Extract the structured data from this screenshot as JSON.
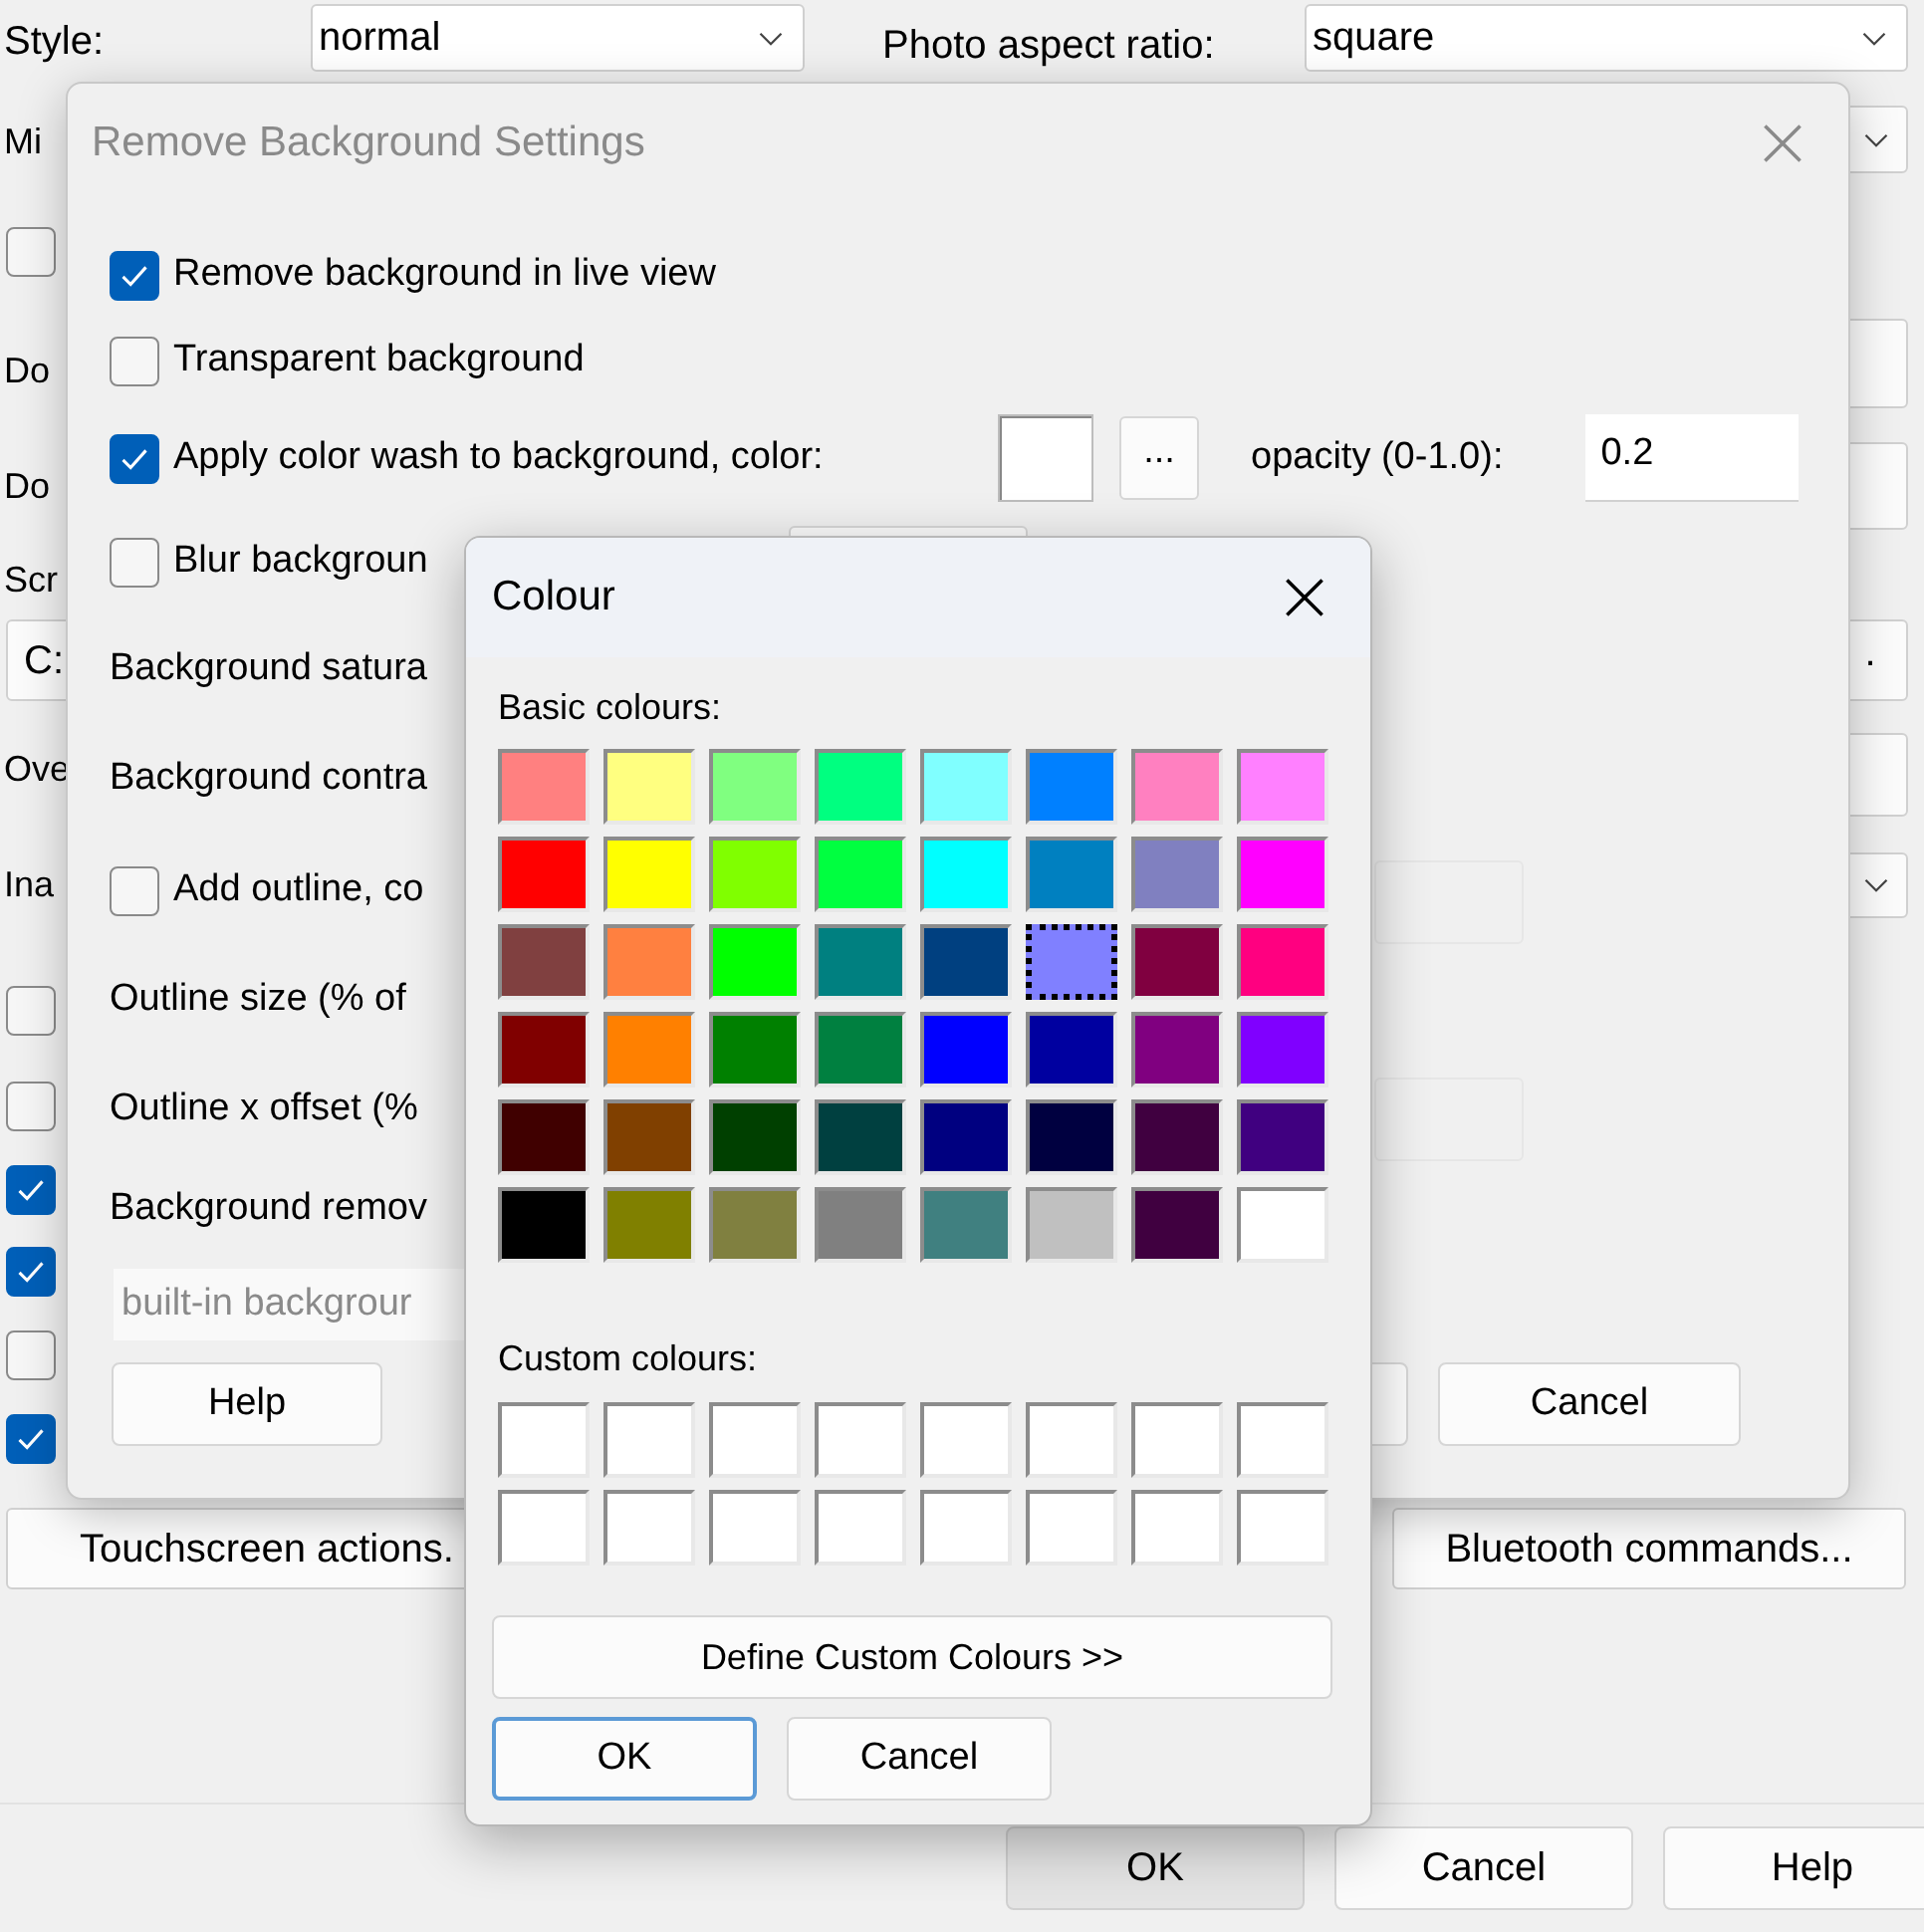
{
  "main_window": {
    "style_label": "Style:",
    "style_value": "normal",
    "aspect_label": "Photo aspect ratio:",
    "aspect_value": "square",
    "left_labels": [
      "Mi",
      "Do",
      "Do",
      "Scr",
      "Ove",
      "Ina"
    ],
    "path_field": "C:",
    "checkboxes": [
      {
        "checked": false
      },
      {
        "checked": false
      },
      {
        "checked": false
      },
      {
        "checked": true
      },
      {
        "checked": true
      },
      {
        "checked": false
      },
      {
        "checked": true
      }
    ],
    "right_controls": [
      {
        "kind": "dropdown"
      },
      {
        "kind": "field"
      },
      {
        "kind": "field"
      },
      {
        "kind": "button",
        "label": "."
      },
      {
        "kind": "field"
      },
      {
        "kind": "dropdown"
      }
    ],
    "buttons": [
      "Touchscreen actions.",
      "Bluetooth commands..."
    ],
    "footer_buttons": [
      {
        "label": "OK",
        "default": true
      },
      {
        "label": "Cancel",
        "default": false
      },
      {
        "label": "Help",
        "default": false
      }
    ]
  },
  "settings_dialog": {
    "title": "Remove Background Settings",
    "active": false,
    "rows": [
      {
        "kind": "checkbox",
        "label": "Remove background in live view",
        "checked": true
      },
      {
        "kind": "checkbox",
        "label": "Transparent background",
        "checked": false
      },
      {
        "kind": "color",
        "label": "Apply color wash to background, color:",
        "checked": true,
        "color": "#ffffff",
        "picker": "...",
        "opacity_label": "opacity (0-1.0):",
        "opacity": "0.2"
      },
      {
        "kind": "checkbox",
        "label": "Blur backgroun",
        "checked": false,
        "field_enabled": true
      },
      {
        "kind": "label",
        "label": "Background satura"
      },
      {
        "kind": "label",
        "label": "Background contra"
      },
      {
        "kind": "checkbox",
        "label": "Add outline, co",
        "checked": false,
        "field_enabled": false
      },
      {
        "kind": "label",
        "label": "Outline size (% of"
      },
      {
        "kind": "label",
        "label": "Outline x offset (%",
        "field_enabled": false
      },
      {
        "kind": "label",
        "label": "Background remov"
      },
      {
        "kind": "dropdown",
        "value": "built-in backgrour",
        "disabled": true
      }
    ],
    "buttons": [
      {
        "kind": "text",
        "label": "Help"
      },
      {
        "kind": "covered"
      },
      {
        "kind": "text",
        "label": "Cancel"
      }
    ]
  },
  "colour_dialog": {
    "title": "Colour",
    "active": true,
    "basic_label": "Basic colours:",
    "basic": [
      {
        "color": "#ff8080",
        "selected": false
      },
      {
        "color": "#ffff80",
        "selected": false
      },
      {
        "color": "#80ff80",
        "selected": false
      },
      {
        "color": "#00ff80",
        "selected": false
      },
      {
        "color": "#80ffff",
        "selected": false
      },
      {
        "color": "#0080ff",
        "selected": false
      },
      {
        "color": "#ff80c0",
        "selected": false
      },
      {
        "color": "#ff80ff",
        "selected": false
      },
      {
        "color": "#ff0000",
        "selected": false
      },
      {
        "color": "#ffff00",
        "selected": false
      },
      {
        "color": "#80ff00",
        "selected": false
      },
      {
        "color": "#00ff40",
        "selected": false
      },
      {
        "color": "#00ffff",
        "selected": false
      },
      {
        "color": "#0080c0",
        "selected": false
      },
      {
        "color": "#8080c0",
        "selected": false
      },
      {
        "color": "#ff00ff",
        "selected": false
      },
      {
        "color": "#804040",
        "selected": false
      },
      {
        "color": "#ff8040",
        "selected": false
      },
      {
        "color": "#00ff00",
        "selected": false
      },
      {
        "color": "#008080",
        "selected": false
      },
      {
        "color": "#004080",
        "selected": false
      },
      {
        "color": "#8080ff",
        "selected": true
      },
      {
        "color": "#800040",
        "selected": false
      },
      {
        "color": "#ff0080",
        "selected": false
      },
      {
        "color": "#800000",
        "selected": false
      },
      {
        "color": "#ff8000",
        "selected": false
      },
      {
        "color": "#008000",
        "selected": false
      },
      {
        "color": "#008040",
        "selected": false
      },
      {
        "color": "#0000ff",
        "selected": false
      },
      {
        "color": "#0000a0",
        "selected": false
      },
      {
        "color": "#800080",
        "selected": false
      },
      {
        "color": "#8000ff",
        "selected": false
      },
      {
        "color": "#400000",
        "selected": false
      },
      {
        "color": "#804000",
        "selected": false
      },
      {
        "color": "#004000",
        "selected": false
      },
      {
        "color": "#004040",
        "selected": false
      },
      {
        "color": "#000080",
        "selected": false
      },
      {
        "color": "#000040",
        "selected": false
      },
      {
        "color": "#400040",
        "selected": false
      },
      {
        "color": "#400080",
        "selected": false
      },
      {
        "color": "#000000",
        "selected": false
      },
      {
        "color": "#808000",
        "selected": false
      },
      {
        "color": "#808040",
        "selected": false
      },
      {
        "color": "#808080",
        "selected": false
      },
      {
        "color": "#408080",
        "selected": false
      },
      {
        "color": "#c0c0c0",
        "selected": false
      },
      {
        "color": "#400040",
        "selected": false
      },
      {
        "color": "#ffffff",
        "selected": false
      }
    ],
    "custom_label": "Custom colours:",
    "custom": [
      {
        "color": "#ffffff"
      },
      {
        "color": "#ffffff"
      },
      {
        "color": "#ffffff"
      },
      {
        "color": "#ffffff"
      },
      {
        "color": "#ffffff"
      },
      {
        "color": "#ffffff"
      },
      {
        "color": "#ffffff"
      },
      {
        "color": "#ffffff"
      },
      {
        "color": "#ffffff"
      },
      {
        "color": "#ffffff"
      },
      {
        "color": "#ffffff"
      },
      {
        "color": "#ffffff"
      },
      {
        "color": "#ffffff"
      },
      {
        "color": "#ffffff"
      },
      {
        "color": "#ffffff"
      },
      {
        "color": "#ffffff"
      }
    ],
    "define": "Define Custom Colours >>",
    "buttons": [
      {
        "label": "OK",
        "focused": true
      },
      {
        "label": "Cancel",
        "focused": false
      }
    ]
  }
}
